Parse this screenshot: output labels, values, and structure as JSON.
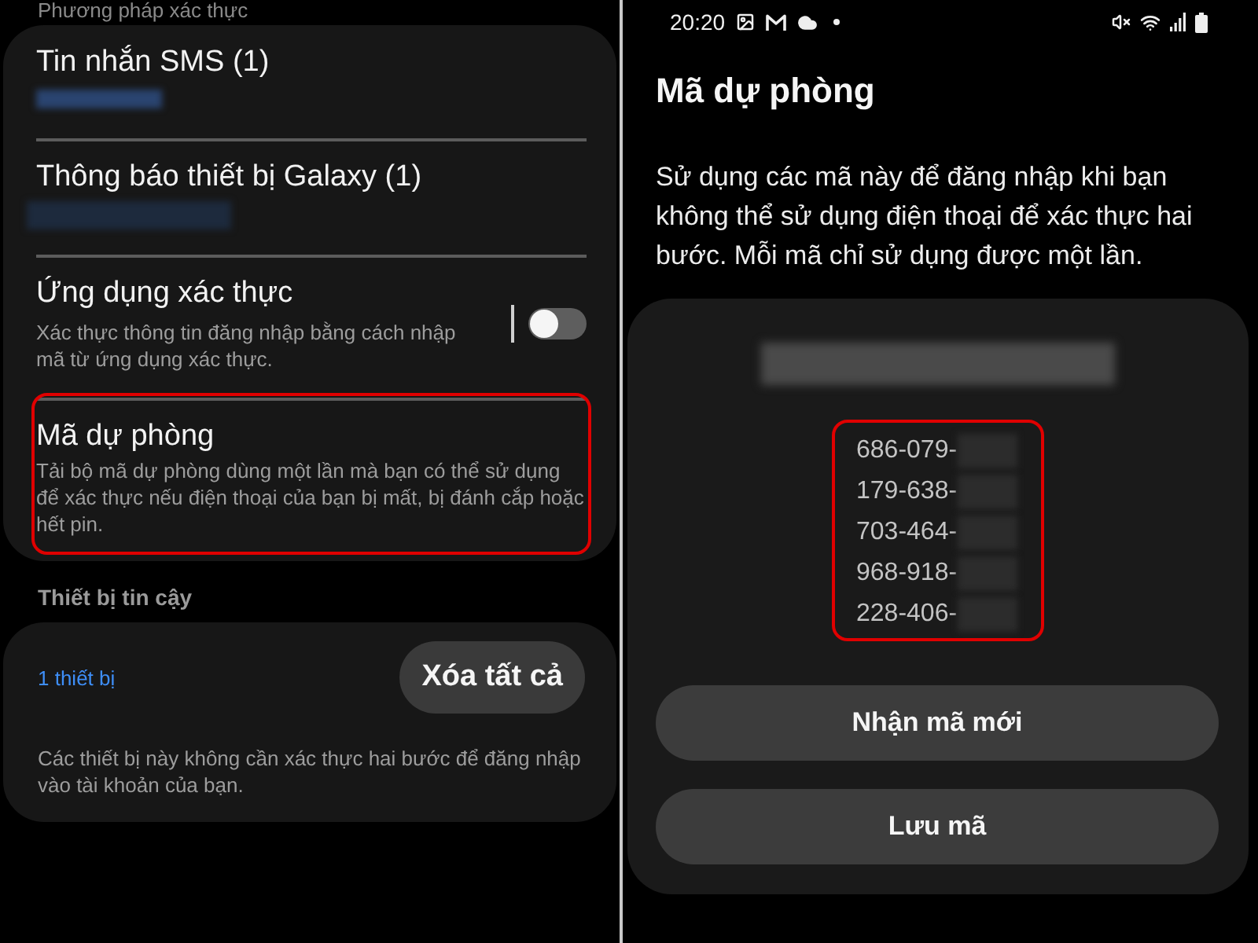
{
  "left_screen": {
    "section_header": "Phương pháp xác thực",
    "methods": [
      {
        "kind": "redacted",
        "title": "Tin nhắn SMS (1)",
        "highlighted": false
      },
      {
        "kind": "redacted",
        "title": "Thông báo thiết bị Galaxy (1)",
        "highlighted": false
      },
      {
        "kind": "toggle",
        "title": "Ứng dụng xác thực",
        "description": "Xác thực thông tin đăng nhập bằng cách nhập mã từ ứng dụng xác thực.",
        "on": false,
        "highlighted": false
      },
      {
        "kind": "text",
        "title": "Mã dự phòng",
        "description": "Tải bộ mã dự phòng dùng một lần mà bạn có thể sử dụng để xác thực nếu điện thoại của bạn bị mất, bị đánh cắp hoặc hết pin.",
        "highlighted": true
      }
    ],
    "trusted_section": {
      "header": "Thiết bị tin cậy",
      "link": "1 thiết bị",
      "button": "Xóa tất cả",
      "note": "Các thiết bị này không cần xác thực hai bước để đăng nhập vào tài khoản của bạn."
    }
  },
  "right_screen": {
    "status_bar": {
      "time": "20:20"
    },
    "title": "Mã dự phòng",
    "description": "Sử dụng các mã này để đăng nhập khi bạn không thể sử dụng điện thoại để xác thực hai bước. Mỗi mã chỉ sử dụng được một lần.",
    "codes": {
      "highlighted": true,
      "items": [
        "686-079-",
        "179-638-",
        "703-464-",
        "968-918-",
        "228-406-"
      ]
    },
    "buttons": [
      "Nhận mã mới",
      "Lưu mã"
    ]
  }
}
